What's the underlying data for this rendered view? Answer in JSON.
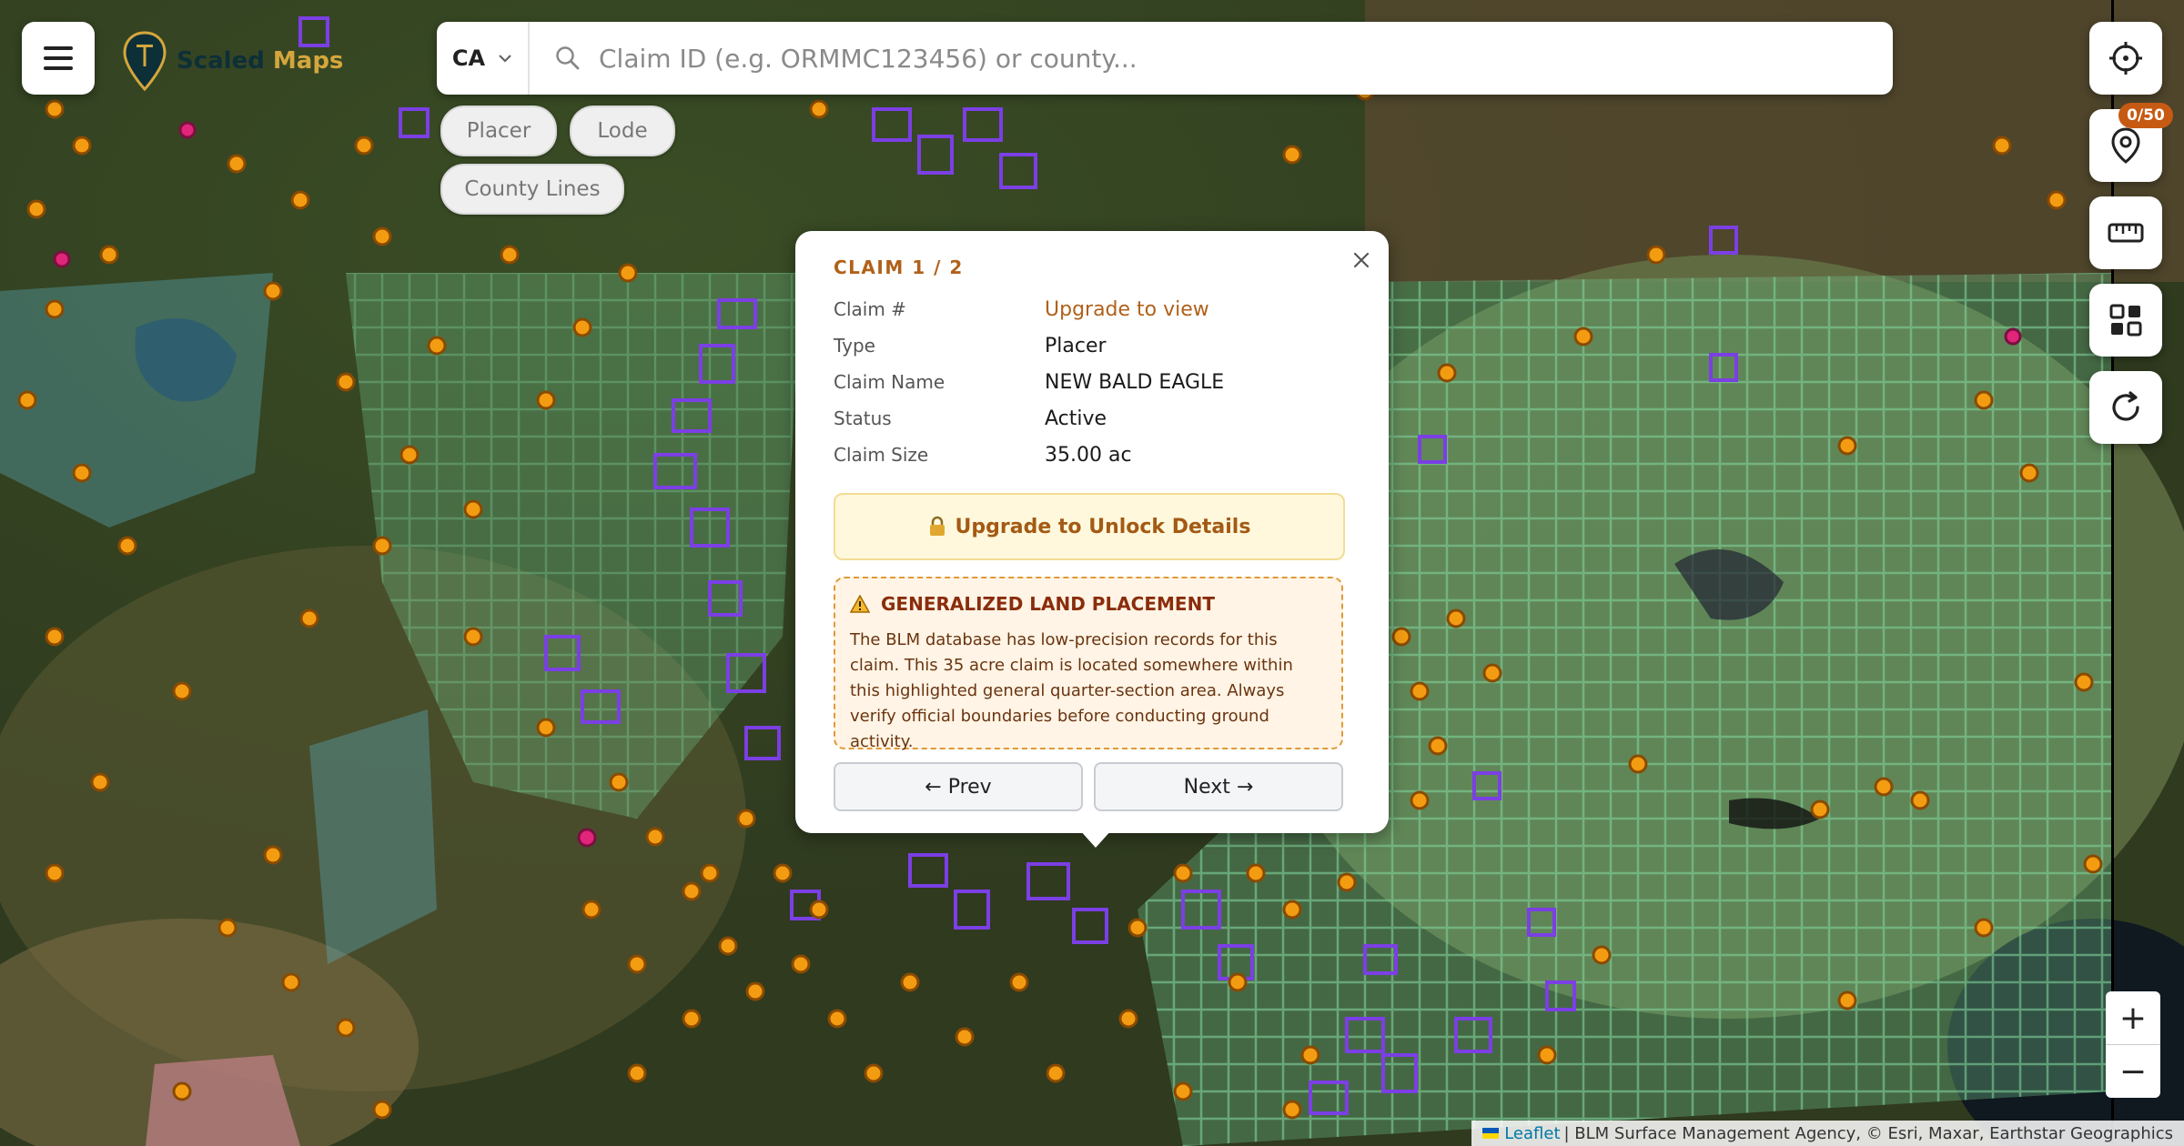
{
  "app": {
    "logo_brand": "Scaled",
    "logo_name": "Maps"
  },
  "search": {
    "state": "CA",
    "placeholder": "Claim ID (e.g. ORMMC123456) or county..."
  },
  "filters": {
    "placer": "Placer",
    "lode": "Lode",
    "county_lines": "County Lines"
  },
  "pins": {
    "counter": "0/50"
  },
  "popup": {
    "heading": "CLAIM 1 / 2",
    "rows": [
      {
        "label": "Claim #",
        "value": "Upgrade to view"
      },
      {
        "label": "Type",
        "value": "Placer"
      },
      {
        "label": "Claim Name",
        "value": "NEW BALD EAGLE"
      },
      {
        "label": "Status",
        "value": "Active"
      },
      {
        "label": "Claim Size",
        "value": "35.00 ac"
      }
    ],
    "upgrade_button": "Upgrade to Unlock Details",
    "warning": {
      "title": "GENERALIZED LAND PLACEMENT",
      "body": "The BLM database has low-precision records for this claim. This 35 acre claim is located somewhere within this highlighted general quarter-section area. Always verify official boundaries before conducting ground activity."
    },
    "prev": "← Prev",
    "next": "Next →"
  },
  "zoom": {
    "in": "+",
    "out": "−"
  },
  "attribution": {
    "link": "Leaflet",
    "text": "| BLM Surface Management Agency, © Esri, Maxar, Earthstar Geographics"
  },
  "colors": {
    "placer_marker": "#f39c12",
    "lode_outline": "#7b3fe4",
    "blm_land": "#6fc08a",
    "accent": "#b0611a"
  }
}
